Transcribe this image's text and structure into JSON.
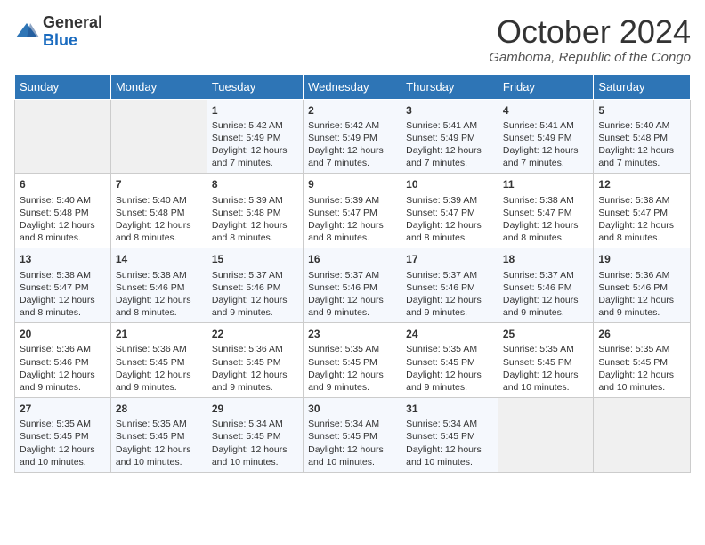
{
  "logo": {
    "general": "General",
    "blue": "Blue"
  },
  "title": "October 2024",
  "location": "Gamboma, Republic of the Congo",
  "days_of_week": [
    "Sunday",
    "Monday",
    "Tuesday",
    "Wednesday",
    "Thursday",
    "Friday",
    "Saturday"
  ],
  "weeks": [
    [
      {
        "day": "",
        "sunrise": "",
        "sunset": "",
        "daylight": ""
      },
      {
        "day": "",
        "sunrise": "",
        "sunset": "",
        "daylight": ""
      },
      {
        "day": "1",
        "sunrise": "Sunrise: 5:42 AM",
        "sunset": "Sunset: 5:49 PM",
        "daylight": "Daylight: 12 hours and 7 minutes."
      },
      {
        "day": "2",
        "sunrise": "Sunrise: 5:42 AM",
        "sunset": "Sunset: 5:49 PM",
        "daylight": "Daylight: 12 hours and 7 minutes."
      },
      {
        "day": "3",
        "sunrise": "Sunrise: 5:41 AM",
        "sunset": "Sunset: 5:49 PM",
        "daylight": "Daylight: 12 hours and 7 minutes."
      },
      {
        "day": "4",
        "sunrise": "Sunrise: 5:41 AM",
        "sunset": "Sunset: 5:49 PM",
        "daylight": "Daylight: 12 hours and 7 minutes."
      },
      {
        "day": "5",
        "sunrise": "Sunrise: 5:40 AM",
        "sunset": "Sunset: 5:48 PM",
        "daylight": "Daylight: 12 hours and 7 minutes."
      }
    ],
    [
      {
        "day": "6",
        "sunrise": "Sunrise: 5:40 AM",
        "sunset": "Sunset: 5:48 PM",
        "daylight": "Daylight: 12 hours and 8 minutes."
      },
      {
        "day": "7",
        "sunrise": "Sunrise: 5:40 AM",
        "sunset": "Sunset: 5:48 PM",
        "daylight": "Daylight: 12 hours and 8 minutes."
      },
      {
        "day": "8",
        "sunrise": "Sunrise: 5:39 AM",
        "sunset": "Sunset: 5:48 PM",
        "daylight": "Daylight: 12 hours and 8 minutes."
      },
      {
        "day": "9",
        "sunrise": "Sunrise: 5:39 AM",
        "sunset": "Sunset: 5:47 PM",
        "daylight": "Daylight: 12 hours and 8 minutes."
      },
      {
        "day": "10",
        "sunrise": "Sunrise: 5:39 AM",
        "sunset": "Sunset: 5:47 PM",
        "daylight": "Daylight: 12 hours and 8 minutes."
      },
      {
        "day": "11",
        "sunrise": "Sunrise: 5:38 AM",
        "sunset": "Sunset: 5:47 PM",
        "daylight": "Daylight: 12 hours and 8 minutes."
      },
      {
        "day": "12",
        "sunrise": "Sunrise: 5:38 AM",
        "sunset": "Sunset: 5:47 PM",
        "daylight": "Daylight: 12 hours and 8 minutes."
      }
    ],
    [
      {
        "day": "13",
        "sunrise": "Sunrise: 5:38 AM",
        "sunset": "Sunset: 5:47 PM",
        "daylight": "Daylight: 12 hours and 8 minutes."
      },
      {
        "day": "14",
        "sunrise": "Sunrise: 5:38 AM",
        "sunset": "Sunset: 5:46 PM",
        "daylight": "Daylight: 12 hours and 8 minutes."
      },
      {
        "day": "15",
        "sunrise": "Sunrise: 5:37 AM",
        "sunset": "Sunset: 5:46 PM",
        "daylight": "Daylight: 12 hours and 9 minutes."
      },
      {
        "day": "16",
        "sunrise": "Sunrise: 5:37 AM",
        "sunset": "Sunset: 5:46 PM",
        "daylight": "Daylight: 12 hours and 9 minutes."
      },
      {
        "day": "17",
        "sunrise": "Sunrise: 5:37 AM",
        "sunset": "Sunset: 5:46 PM",
        "daylight": "Daylight: 12 hours and 9 minutes."
      },
      {
        "day": "18",
        "sunrise": "Sunrise: 5:37 AM",
        "sunset": "Sunset: 5:46 PM",
        "daylight": "Daylight: 12 hours and 9 minutes."
      },
      {
        "day": "19",
        "sunrise": "Sunrise: 5:36 AM",
        "sunset": "Sunset: 5:46 PM",
        "daylight": "Daylight: 12 hours and 9 minutes."
      }
    ],
    [
      {
        "day": "20",
        "sunrise": "Sunrise: 5:36 AM",
        "sunset": "Sunset: 5:46 PM",
        "daylight": "Daylight: 12 hours and 9 minutes."
      },
      {
        "day": "21",
        "sunrise": "Sunrise: 5:36 AM",
        "sunset": "Sunset: 5:45 PM",
        "daylight": "Daylight: 12 hours and 9 minutes."
      },
      {
        "day": "22",
        "sunrise": "Sunrise: 5:36 AM",
        "sunset": "Sunset: 5:45 PM",
        "daylight": "Daylight: 12 hours and 9 minutes."
      },
      {
        "day": "23",
        "sunrise": "Sunrise: 5:35 AM",
        "sunset": "Sunset: 5:45 PM",
        "daylight": "Daylight: 12 hours and 9 minutes."
      },
      {
        "day": "24",
        "sunrise": "Sunrise: 5:35 AM",
        "sunset": "Sunset: 5:45 PM",
        "daylight": "Daylight: 12 hours and 9 minutes."
      },
      {
        "day": "25",
        "sunrise": "Sunrise: 5:35 AM",
        "sunset": "Sunset: 5:45 PM",
        "daylight": "Daylight: 12 hours and 10 minutes."
      },
      {
        "day": "26",
        "sunrise": "Sunrise: 5:35 AM",
        "sunset": "Sunset: 5:45 PM",
        "daylight": "Daylight: 12 hours and 10 minutes."
      }
    ],
    [
      {
        "day": "27",
        "sunrise": "Sunrise: 5:35 AM",
        "sunset": "Sunset: 5:45 PM",
        "daylight": "Daylight: 12 hours and 10 minutes."
      },
      {
        "day": "28",
        "sunrise": "Sunrise: 5:35 AM",
        "sunset": "Sunset: 5:45 PM",
        "daylight": "Daylight: 12 hours and 10 minutes."
      },
      {
        "day": "29",
        "sunrise": "Sunrise: 5:34 AM",
        "sunset": "Sunset: 5:45 PM",
        "daylight": "Daylight: 12 hours and 10 minutes."
      },
      {
        "day": "30",
        "sunrise": "Sunrise: 5:34 AM",
        "sunset": "Sunset: 5:45 PM",
        "daylight": "Daylight: 12 hours and 10 minutes."
      },
      {
        "day": "31",
        "sunrise": "Sunrise: 5:34 AM",
        "sunset": "Sunset: 5:45 PM",
        "daylight": "Daylight: 12 hours and 10 minutes."
      },
      {
        "day": "",
        "sunrise": "",
        "sunset": "",
        "daylight": ""
      },
      {
        "day": "",
        "sunrise": "",
        "sunset": "",
        "daylight": ""
      }
    ]
  ]
}
